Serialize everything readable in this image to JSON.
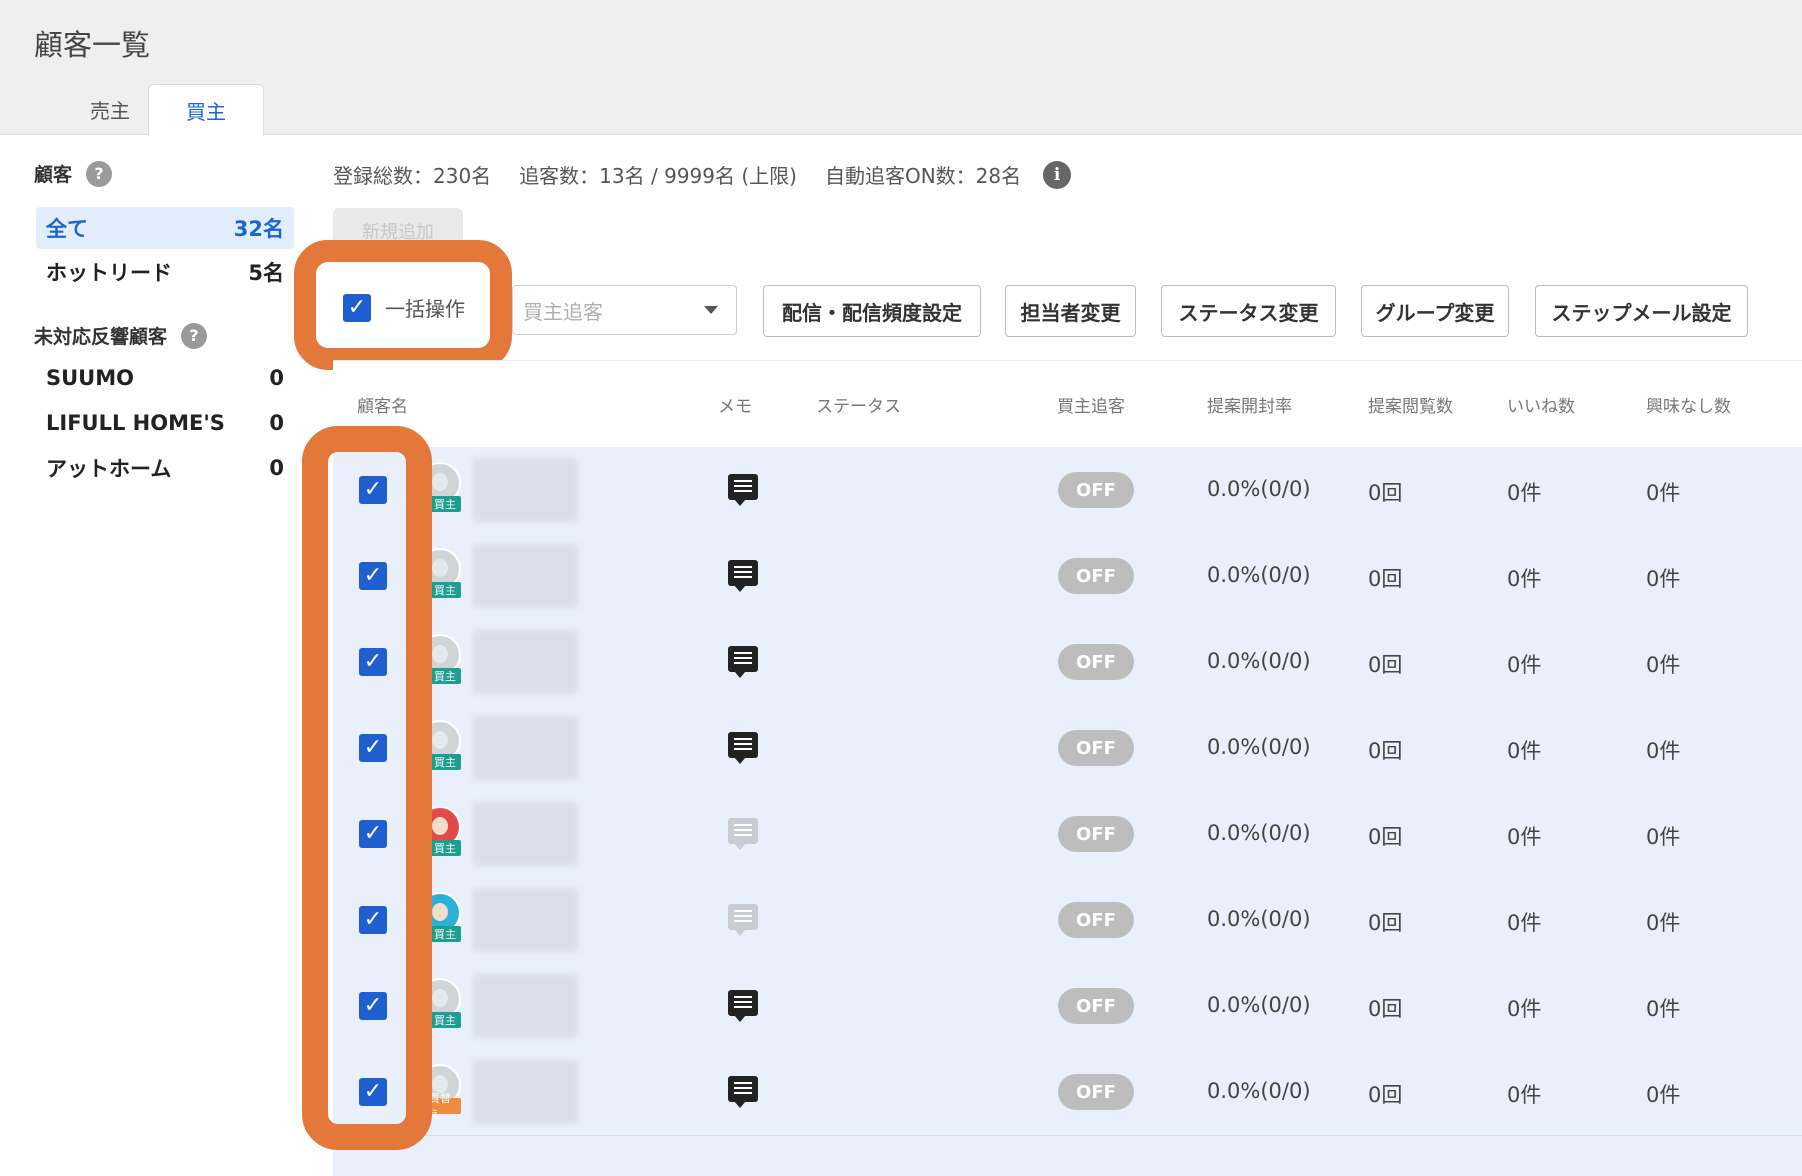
{
  "page": {
    "title": "顧客一覧"
  },
  "tabs": [
    {
      "label": "売主"
    },
    {
      "label": "買主"
    }
  ],
  "sidebar": {
    "customers_heading": "顧客",
    "items": [
      {
        "label": "全て",
        "count": "32名"
      },
      {
        "label": "ホットリード",
        "count": "5名"
      }
    ],
    "unhandled_heading": "未対応反響顧客",
    "portals": [
      {
        "label": "SUUMO",
        "count": "0"
      },
      {
        "label": "LIFULL HOME'S",
        "count": "0"
      },
      {
        "label": "アットホーム",
        "count": "0"
      }
    ],
    "help_glyph": "?"
  },
  "stats": {
    "registered": "登録総数：230名",
    "tracked": "追客数：13名 / 9999名 (上限)",
    "auto_tracking": "自動追客ON数：28名",
    "info_glyph": "i"
  },
  "toolbar": {
    "new_button": "新規追加",
    "bulk_label": "一括操作",
    "dropdown_placeholder": "買主追客",
    "buttons": [
      "配信・配信頻度設定",
      "担当者変更",
      "ステータス変更",
      "グループ変更",
      "ステップメール設定"
    ]
  },
  "table": {
    "headers": {
      "name": "顧客名",
      "memo": "メモ",
      "status": "ステータス",
      "tracking": "買主追客",
      "open_rate": "提案開封率",
      "views": "提案閲覧数",
      "likes": "いいね数",
      "not_interested": "興味なし数"
    },
    "check_glyph": "✓",
    "rows": [
      {
        "tag": "買主",
        "avatar": "gray",
        "memo": "dark",
        "toggle": "OFF",
        "open_rate": "0.0%(0/0)",
        "views": "0回",
        "likes": "0件",
        "not_interested": "0件"
      },
      {
        "tag": "買主",
        "avatar": "gray",
        "memo": "dark",
        "toggle": "OFF",
        "open_rate": "0.0%(0/0)",
        "views": "0回",
        "likes": "0件",
        "not_interested": "0件"
      },
      {
        "tag": "買主",
        "avatar": "gray",
        "memo": "dark",
        "toggle": "OFF",
        "open_rate": "0.0%(0/0)",
        "views": "0回",
        "likes": "0件",
        "not_interested": "0件"
      },
      {
        "tag": "買主",
        "avatar": "gray",
        "memo": "dark",
        "toggle": "OFF",
        "open_rate": "0.0%(0/0)",
        "views": "0回",
        "likes": "0件",
        "not_interested": "0件"
      },
      {
        "tag": "買主",
        "avatar": "red",
        "memo": "faint",
        "toggle": "OFF",
        "open_rate": "0.0%(0/0)",
        "views": "0回",
        "likes": "0件",
        "not_interested": "0件"
      },
      {
        "tag": "買主",
        "avatar": "cyan",
        "memo": "faint",
        "toggle": "OFF",
        "open_rate": "0.0%(0/0)",
        "views": "0回",
        "likes": "0件",
        "not_interested": "0件"
      },
      {
        "tag": "買主",
        "avatar": "gray",
        "memo": "dark",
        "toggle": "OFF",
        "open_rate": "0.0%(0/0)",
        "views": "0回",
        "likes": "0件",
        "not_interested": "0件"
      },
      {
        "tag": "買替え",
        "avatar": "gray",
        "memo": "dark",
        "toggle": "OFF",
        "open_rate": "0.0%(0/0)",
        "views": "0回",
        "likes": "0件",
        "not_interested": "0件"
      }
    ]
  },
  "colors": {
    "accent": "#1a66d6",
    "highlight": "#e3783a",
    "row_selected": "#e9f0fb",
    "toggle_off": "#bdbdbd"
  }
}
